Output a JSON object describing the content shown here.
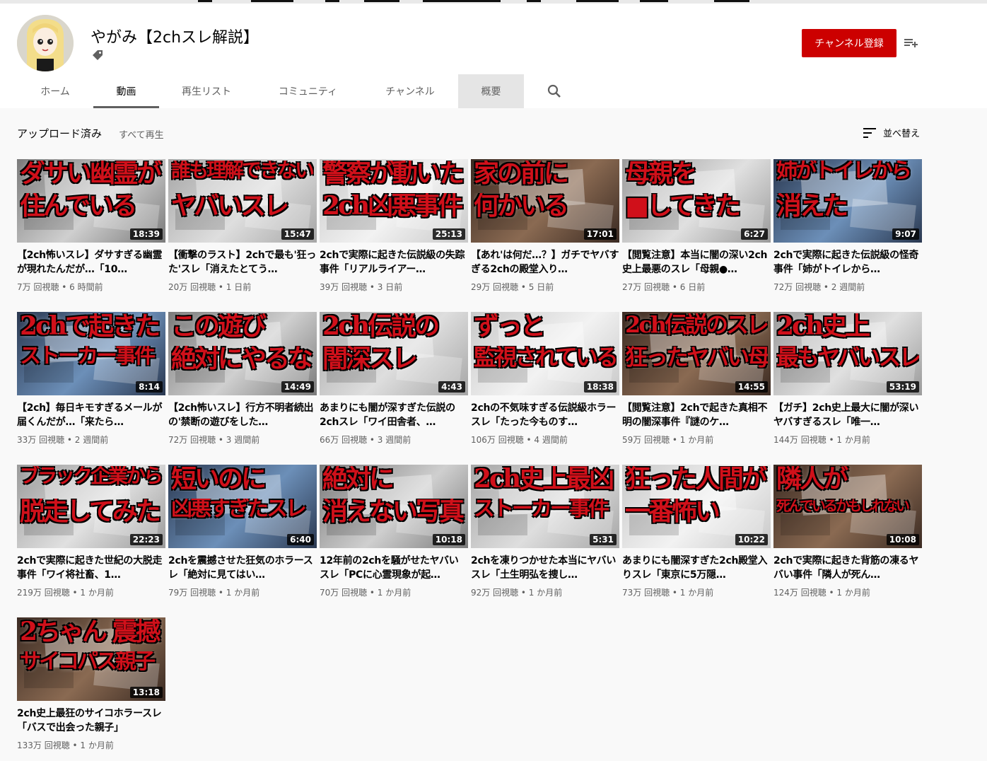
{
  "channel": {
    "name": "やがみ【2chスレ解説】",
    "subscribe_label": "チャンネル登録"
  },
  "tabs": [
    {
      "label": "ホーム"
    },
    {
      "label": "動画"
    },
    {
      "label": "再生リスト"
    },
    {
      "label": "コミュニティ"
    },
    {
      "label": "チャンネル"
    },
    {
      "label": "概要"
    }
  ],
  "section": {
    "title": "アップロード済み",
    "play_all": "すべて再生",
    "sort_label": "並べ替え"
  },
  "colors": {
    "subscribe": "#cc0000",
    "thumb_text": "#d0101a"
  },
  "icons": [
    "tag-icon",
    "playlist-add-icon",
    "search-icon",
    "sort-icon"
  ],
  "videos": [
    {
      "thumb_line1": "ダサい幽霊が",
      "thumb_line2": "住んでいる",
      "duration": "18:39",
      "title": "【2ch怖いスレ】ダサすぎる幽霊が現れたんだが…「10…",
      "meta": "7万 回視聴 • 6 時間前"
    },
    {
      "thumb_line1": "誰も理解できない",
      "thumb_line2": "ヤバいスレ",
      "duration": "15:47",
      "title": "【衝撃のラスト】2chで最も'狂った'スレ「消えたとてう…",
      "meta": "20万 回視聴 • 1 日前"
    },
    {
      "thumb_line1": "警察が動いた",
      "thumb_line2": "2ch凶悪事件",
      "duration": "25:13",
      "title": "2chで実際に起きた伝説級の失踪事件「リアルライアー…",
      "meta": "39万 回視聴 • 3 日前"
    },
    {
      "thumb_line1": "家の前に",
      "thumb_line2": "何かいる",
      "duration": "17:01",
      "title": "【あれ'は何だ…？】ガチでヤバすぎる2chの殿堂入り…",
      "meta": "29万 回視聴 • 5 日前"
    },
    {
      "thumb_line1": "母親を",
      "thumb_line2": "■してきた",
      "duration": "6:27",
      "title": "【閲覧注意】本当に闇の深い2ch史上最悪のスレ「母親●…",
      "meta": "27万 回視聴 • 6 日前"
    },
    {
      "thumb_line1": "姉がトイレから",
      "thumb_line2": "消えた",
      "duration": "9:07",
      "title": "2chで実際に起きた伝説級の怪奇事件「姉がトイレから…",
      "meta": "72万 回視聴 • 2 週間前"
    },
    {
      "thumb_line1": "2chで起きた",
      "thumb_line2": "ストーカー事件",
      "duration": "8:14",
      "title": "【2ch】毎日キモすぎるメールが届くんだが…「来たら…",
      "meta": "33万 回視聴 • 2 週間前"
    },
    {
      "thumb_line1": "この遊び",
      "thumb_line2": "絶対にやるな",
      "duration": "14:49",
      "title": "【2ch怖いスレ】行方不明者続出の'禁断の遊びをした…",
      "meta": "72万 回視聴 • 3 週間前"
    },
    {
      "thumb_line1": "2ch伝説の",
      "thumb_line2": "闇深スレ",
      "duration": "4:43",
      "title": "あまりにも闇が深すぎた伝説の2chスレ「ワイ田舎者、…",
      "meta": "66万 回視聴 • 3 週間前"
    },
    {
      "thumb_line1": "ずっと",
      "thumb_line2": "監視されている",
      "duration": "18:38",
      "title": "2chの不気味すぎる伝説級ホラースレ「たった今ものす…",
      "meta": "106万 回視聴 • 4 週間前"
    },
    {
      "thumb_line1": "2ch伝説のスレ",
      "thumb_line2": "狂ったヤバい母",
      "duration": "14:55",
      "title": "【閲覧注意】2chで起きた真相不明の闇深事件『謎のケ…",
      "meta": "59万 回視聴 • 1 か月前"
    },
    {
      "thumb_line1": "2ch史上",
      "thumb_line2": "最もヤバいスレ",
      "duration": "53:19",
      "title": "【ガチ】2ch史上最大に闇が深いヤバすぎるスレ「唯一…",
      "meta": "144万 回視聴 • 1 か月前"
    },
    {
      "thumb_line1": "ブラック企業から",
      "thumb_line2": "脱走してみた",
      "duration": "22:23",
      "title": "2chで実際に起きた世紀の大脱走事件「ワイ将社畜、1…",
      "meta": "219万 回視聴 • 1 か月前"
    },
    {
      "thumb_line1": "短いのに",
      "thumb_line2": "凶悪すぎたスレ",
      "duration": "6:40",
      "title": "2chを震撼させた狂気のホラースレ「絶対に見てはい…",
      "meta": "79万 回視聴 • 1 か月前"
    },
    {
      "thumb_line1": "絶対に",
      "thumb_line2": "消えない写真",
      "duration": "10:18",
      "title": "12年前の2chを騒がせたヤバいスレ「PCに心霊現象が起…",
      "meta": "70万 回視聴 • 1 か月前"
    },
    {
      "thumb_line1": "2ch史上最凶",
      "thumb_line2": "ストーカー事件",
      "duration": "5:31",
      "title": "2chを凍りつかせた本当にヤバいスレ「土生明弘を捜し…",
      "meta": "92万 回視聴 • 1 か月前"
    },
    {
      "thumb_line1": "狂った人間が",
      "thumb_line2": "一番怖い",
      "duration": "10:22",
      "title": "あまりにも闇深すぎた2ch殿堂入りスレ「東京に5万隠…",
      "meta": "73万 回視聴 • 1 か月前"
    },
    {
      "thumb_line1": "隣人が",
      "thumb_line2": "死んでいるかもしれない",
      "duration": "10:08",
      "title": "2chで実際に起きた背筋の凍るヤバい事件「隣人が死ん…",
      "meta": "124万 回視聴 • 1 か月前"
    },
    {
      "thumb_line1": "2ちゃん 震撼",
      "thumb_line2": "サイコパス親子",
      "duration": "13:18",
      "title": "2ch史上最狂のサイコホラースレ「バスで出会った親子」",
      "meta": "133万 回視聴 • 1 か月前"
    }
  ]
}
